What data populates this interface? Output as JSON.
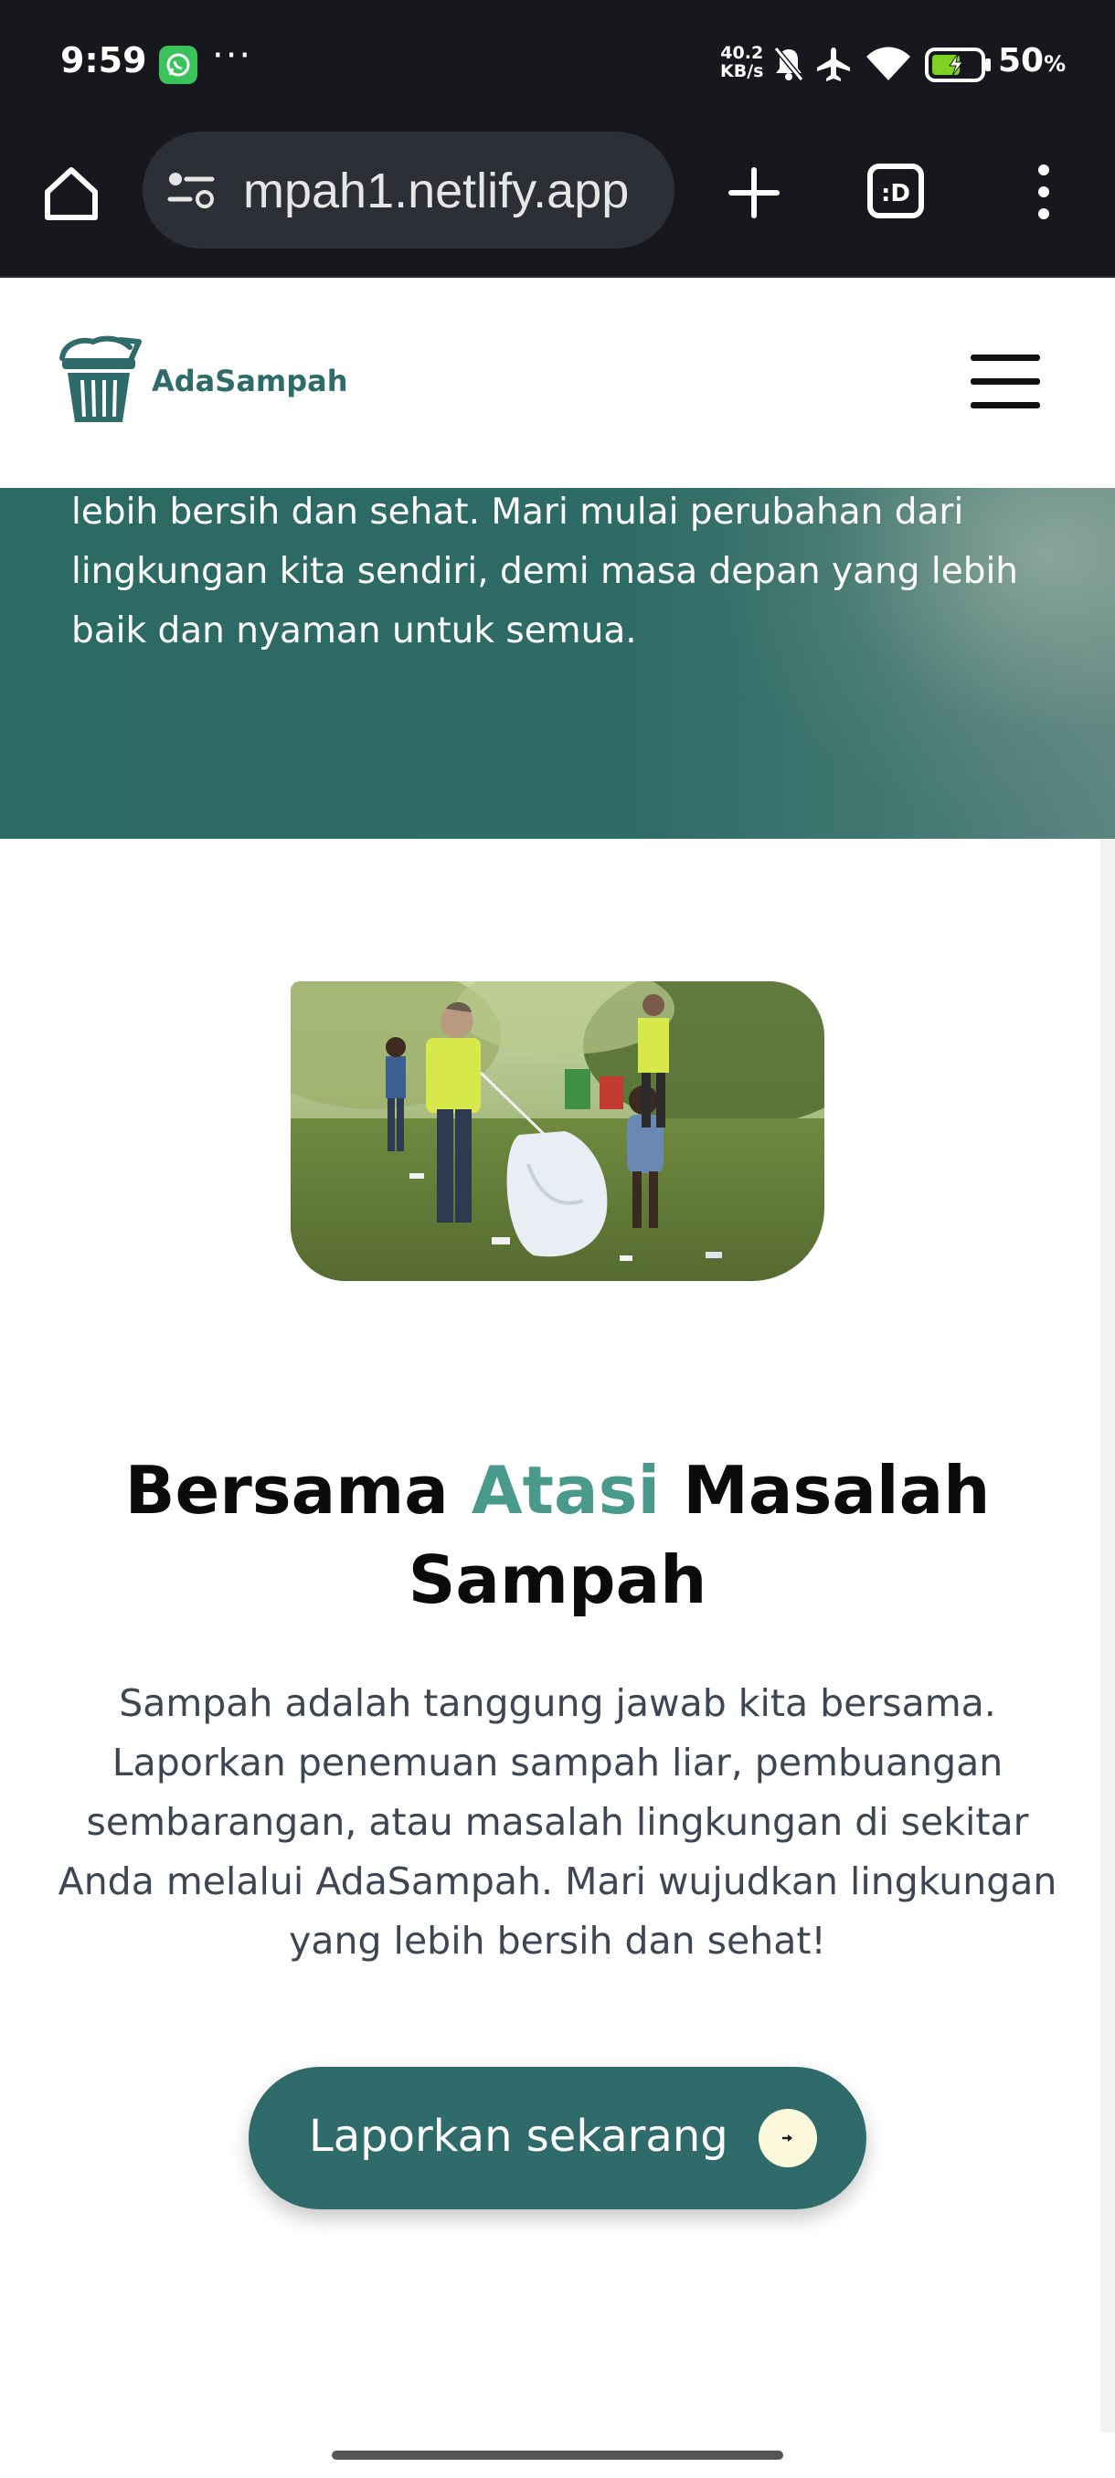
{
  "status_bar": {
    "time": "9:59",
    "more_indicator": "···",
    "net_speed_value": "40.2",
    "net_speed_unit": "KB/s",
    "battery_percent": "50",
    "battery_unit": "%",
    "icons": [
      "whatsapp-icon",
      "bell-off-icon",
      "airplane-icon",
      "wifi-icon",
      "battery-charging-icon"
    ]
  },
  "browser": {
    "url": "mpah1.netlify.app",
    "buttons": [
      "home-icon",
      "site-settings-icon",
      "new-tab-icon",
      "tab-switcher-icon",
      "more-menu-icon"
    ],
    "tab_switcher_label": ":D"
  },
  "site": {
    "logo_text": "AdaSampah",
    "logo_color": "#2e6b6a",
    "accent_color": "#4a9a8c"
  },
  "hero": {
    "text": "lebih bersih dan sehat. Mari mulai perubahan dari lingkungan kita sendiri, demi masa depan yang lebih baik dan nyaman untuk semua."
  },
  "section": {
    "heading_part1": "Bersama ",
    "heading_accent": "Atasi",
    "heading_part2": " Masalah Sampah",
    "body": "Sampah adalah tanggung jawab kita bersama. Laporkan penemuan sampah liar, pembuangan sembarangan, atau masalah lingkungan di sekitar Anda melalui AdaSampah. Mari wujudkan lingkungan yang lebih bersih dan sehat!",
    "cta_label": "Laporkan sekarang"
  }
}
